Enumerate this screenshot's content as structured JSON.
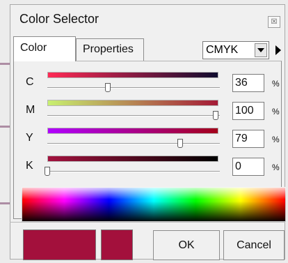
{
  "window": {
    "title": "Color Selector",
    "close_glyph": "☒"
  },
  "tabs": [
    {
      "label": "Color",
      "active": true
    },
    {
      "label": "Properties",
      "active": false
    }
  ],
  "mode_select": {
    "value": "CMYK"
  },
  "channels": [
    {
      "label": "C",
      "value": "36",
      "unit": "%",
      "level": 0.36,
      "gradient": [
        "#ff2a55",
        "#0f0b2e"
      ]
    },
    {
      "label": "M",
      "value": "100",
      "unit": "%",
      "level": 1.0,
      "gradient": [
        "#c8f070",
        "#a41a36"
      ]
    },
    {
      "label": "Y",
      "value": "79",
      "unit": "%",
      "level": 0.79,
      "gradient": [
        "#b000ff",
        "#a3001a"
      ]
    },
    {
      "label": "K",
      "value": "0",
      "unit": "%",
      "level": 0.0,
      "gradient": [
        "#a3123e",
        "#000000"
      ]
    }
  ],
  "swatches": {
    "current": "#a3103c",
    "previous": "#a3103c"
  },
  "buttons": {
    "ok": "OK",
    "cancel": "Cancel"
  }
}
